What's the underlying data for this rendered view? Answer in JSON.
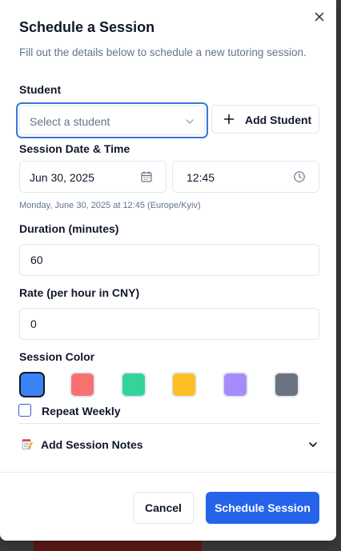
{
  "dialog": {
    "title": "Schedule a Session",
    "subtitle": "Fill out the details below to schedule a new tutoring session."
  },
  "student": {
    "label": "Student",
    "placeholder": "Select a student",
    "add_label": "Add Student"
  },
  "datetime": {
    "label": "Session Date & Time",
    "date_value": "Jun 30, 2025",
    "time_value": "12:45",
    "hint": "Monday, June 30, 2025 at 12:45 (Europe/Kyiv)"
  },
  "duration": {
    "label": "Duration (minutes)",
    "value": "60"
  },
  "rate": {
    "label": "Rate (per hour in CNY)",
    "value": "0"
  },
  "color": {
    "label": "Session Color",
    "swatches": [
      "#3b82f6",
      "#f87171",
      "#34d399",
      "#fbbf24",
      "#a78bfa",
      "#6b7280"
    ],
    "selected_index": 0
  },
  "repeat": {
    "label": "Repeat Weekly",
    "checked": false
  },
  "notes": {
    "label": "Add Session Notes",
    "expanded": false
  },
  "footer": {
    "cancel_label": "Cancel",
    "submit_label": "Schedule Session"
  },
  "theme": {
    "primary": "#2563eb",
    "focus_ring": "#3b74db",
    "text": "#0f172a",
    "muted": "#64748b"
  }
}
